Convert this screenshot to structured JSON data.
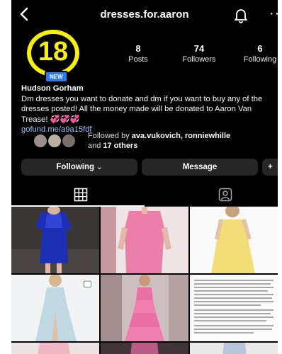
{
  "header": {
    "username": "dresses.for.aaron"
  },
  "profile": {
    "avatar_number": "18",
    "avatar_badge": "NEW",
    "stats": [
      {
        "value": "8",
        "label": "Posts"
      },
      {
        "value": "74",
        "label": "Followers"
      },
      {
        "value": "6",
        "label": "Following"
      }
    ],
    "name": "Hudson Gorham",
    "bio": "Dm dresses you want to donate and dm if you want to buy any of the dresses posted! All the money made will be donated to Aaron Van Trease! 💞💞💞",
    "link": "gofund.me/a9a15fdf",
    "followed_by_prefix": "Followed by ",
    "followed_by_names": "ava.vukovich, ronniewhille",
    "followed_by_and": " and ",
    "followed_by_others": "17 others"
  },
  "actions": {
    "following": "Following",
    "message": "Message",
    "add_person": "+"
  },
  "tabs": [
    {
      "name": "grid-icon",
      "active": true
    },
    {
      "name": "tagged-icon",
      "active": false
    }
  ],
  "colors": {
    "background": "#000000",
    "avatar_yellow": "#f7ef10",
    "badge_blue": "#2d7bf4",
    "button_gray": "#262626",
    "link_blue": "#9cc8ff"
  }
}
